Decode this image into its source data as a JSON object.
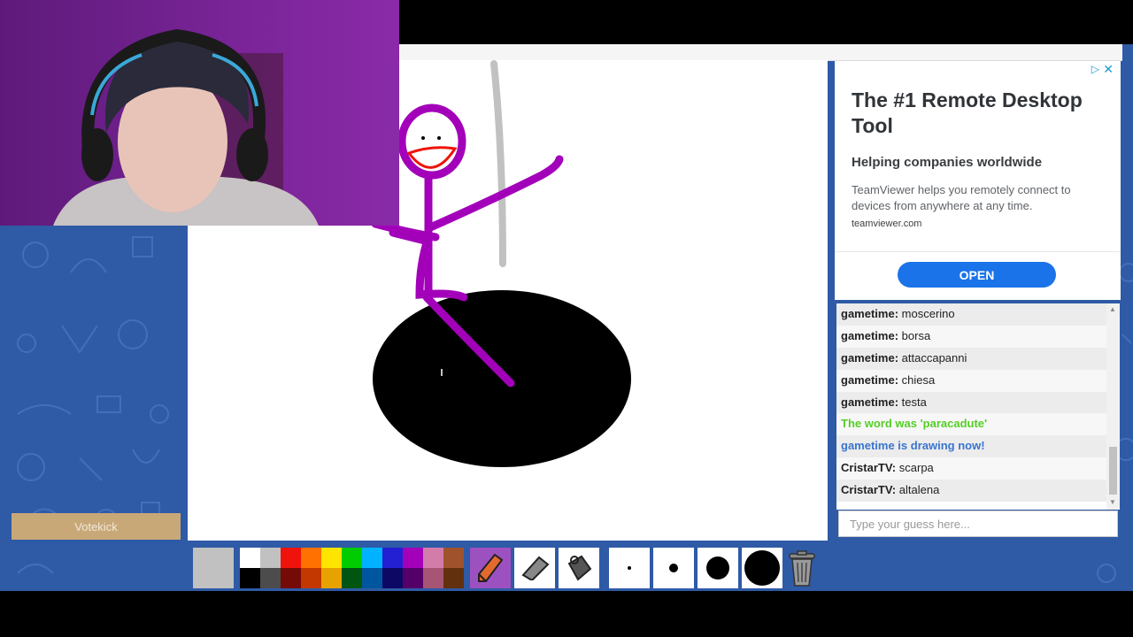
{
  "ad": {
    "title": "The #1 Remote Desktop Tool",
    "subtitle": "Helping companies worldwide",
    "description": "TeamViewer helps you remotely connect to devices from anywhere at any time.",
    "url": "teamviewer.com",
    "button": "OPEN",
    "choices_icon": "ad-choices-icon",
    "close_icon": "close-icon"
  },
  "chat": {
    "messages": [
      {
        "user": "gametime:",
        "text": "moscerino"
      },
      {
        "user": "gametime:",
        "text": "borsa"
      },
      {
        "user": "gametime:",
        "text": "attaccapanni"
      },
      {
        "user": "gametime:",
        "text": "chiesa"
      },
      {
        "user": "gametime:",
        "text": "testa"
      },
      {
        "system": "The word was 'paracadute'",
        "color": "#56ce27"
      },
      {
        "system": "gametime is drawing now!",
        "color": "#3975ce"
      },
      {
        "user": "CristarTV:",
        "text": "scarpa"
      },
      {
        "user": "CristarTV:",
        "text": "altalena"
      }
    ]
  },
  "guess": {
    "placeholder": "Type your guess here..."
  },
  "votekick": {
    "label": "Votekick"
  },
  "toolbar": {
    "current_color": "#c1c1c1",
    "palette_top": [
      "#ffffff",
      "#c1c1c1",
      "#ef130b",
      "#ff7100",
      "#ffe400",
      "#00cc00",
      "#00b2ff",
      "#231fd3",
      "#a300ba",
      "#d37caa",
      "#a0522d"
    ],
    "palette_bottom": [
      "#000000",
      "#4c4c4c",
      "#740b07",
      "#c23800",
      "#e8a200",
      "#005510",
      "#00569e",
      "#0e0865",
      "#550069",
      "#a75574",
      "#63300d"
    ],
    "tools": [
      "pencil-icon",
      "eraser-icon",
      "fill-bucket-icon"
    ],
    "sizes": [
      4,
      10,
      26,
      40
    ],
    "trash_icon": "trash-icon"
  }
}
